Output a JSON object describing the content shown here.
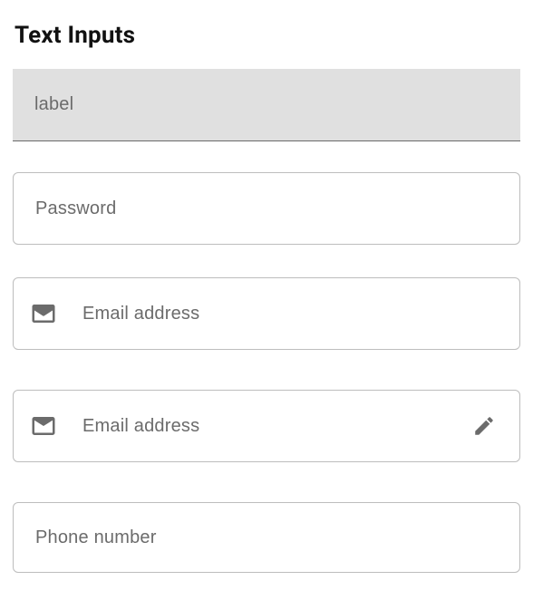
{
  "title": "Text Inputs",
  "fields": {
    "label": {
      "placeholder": "label"
    },
    "password": {
      "placeholder": "Password"
    },
    "email1": {
      "placeholder": "Email address",
      "leadingIcon": "mail-icon"
    },
    "email2": {
      "placeholder": "Email address",
      "leadingIcon": "mail-icon",
      "trailingIcon": "pencil-edit-icon"
    },
    "phone": {
      "placeholder": "Phone number"
    }
  },
  "colors": {
    "filledBg": "#e0e0e0",
    "outline": "#bdbdbd",
    "placeholder": "#6b6b6b",
    "iconGrey": "#6b6b6b"
  }
}
